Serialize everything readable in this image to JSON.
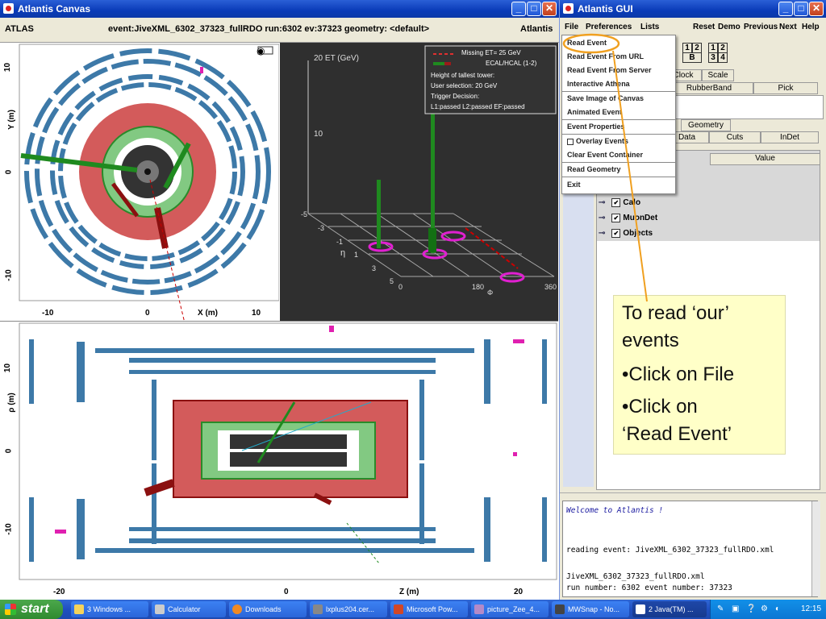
{
  "canvas_window": {
    "title": "Atlantis Canvas",
    "header_left": "ATLAS",
    "header_center": "event:JiveXML_6302_37323_fullRDO run:6302 ev:37323  geometry: <default>",
    "header_right": "Atlantis",
    "yx_view": {
      "ylabel": "Y (m)",
      "xlabel": "X (m)",
      "xticks": [
        "-10",
        "0",
        "10"
      ],
      "yticks": [
        "10",
        "0",
        "-10"
      ]
    },
    "lego_view": {
      "axis_et": "20 ET (GeV)",
      "tick_10": "10",
      "eta_label": "η",
      "phi_label": "Φ",
      "eta_ticks": [
        "-5",
        "-3",
        "-1",
        "1",
        "3",
        "5"
      ],
      "phi_ticks": [
        "0",
        "180",
        "360"
      ],
      "legend": {
        "missing": "Missing ET= 25 GeV",
        "calo": "ECAL/HCAL (1-2)",
        "line1": "Height of tallest tower:",
        "line2": "User selection: 20 GeV",
        "line3": "Trigger Decision:",
        "line4": "L1:passed L2:passed EF:passed"
      }
    },
    "rz_view": {
      "ylabel": "ρ (m)",
      "xlabel": "Z (m)",
      "xticks": [
        "-20",
        "0",
        "20"
      ],
      "yticks": [
        "10",
        "0",
        "-10"
      ]
    }
  },
  "gui_window": {
    "title": "Atlantis GUI",
    "menu": {
      "file": "File",
      "preferences": "Preferences",
      "lists": "Lists",
      "reset": "Reset",
      "demo": "Demo",
      "previous": "Previous",
      "next": "Next",
      "help": "Help"
    },
    "file_menu": [
      "Read Event",
      "Read Event From URL",
      "Read Event From Server",
      "Interactive Athena",
      "Save Image of Canvas",
      "Animated Event",
      "Event Properties",
      "Overlay Events",
      "Clear Event Container",
      "Read Geometry",
      "Exit"
    ],
    "layout_buttons": [
      "1",
      "2",
      "B",
      "1",
      "2",
      "3",
      "4"
    ],
    "tabs_row1": {
      "clock": "Clock",
      "scale": "Scale"
    },
    "tabs_row2": {
      "rubberband": "RubberBand",
      "pick": "Pick"
    },
    "tabs_row3": {
      "geometry": "Geometry"
    },
    "tabs_row4": {
      "data": "Data",
      "cuts": "Cuts",
      "indet": "InDet"
    },
    "table_header": {
      "value": "Value"
    },
    "tree": [
      "Calo",
      "MuonDet",
      "Objects"
    ],
    "console": [
      "Welcome to Atlantis !",
      "reading event: JiveXML_6302_37323_fullRDO.xml",
      "JiveXML_6302_37323_fullRDO.xml",
      "run number: 6302 event number: 37323"
    ]
  },
  "callout": {
    "line1": "To read ‘our’",
    "line2": "events",
    "line3": "•Click on File",
    "line4": "•Click on",
    "line5": "‘Read Event’"
  },
  "taskbar": {
    "start": "start",
    "items": [
      "3 Windows ...",
      "Calculator",
      "Downloads",
      "lxplus204.cer...",
      "Microsoft Pow...",
      "picture_Zee_4...",
      "MWSnap - No...",
      "2 Java(TM) ..."
    ],
    "clock": "12:15"
  }
}
